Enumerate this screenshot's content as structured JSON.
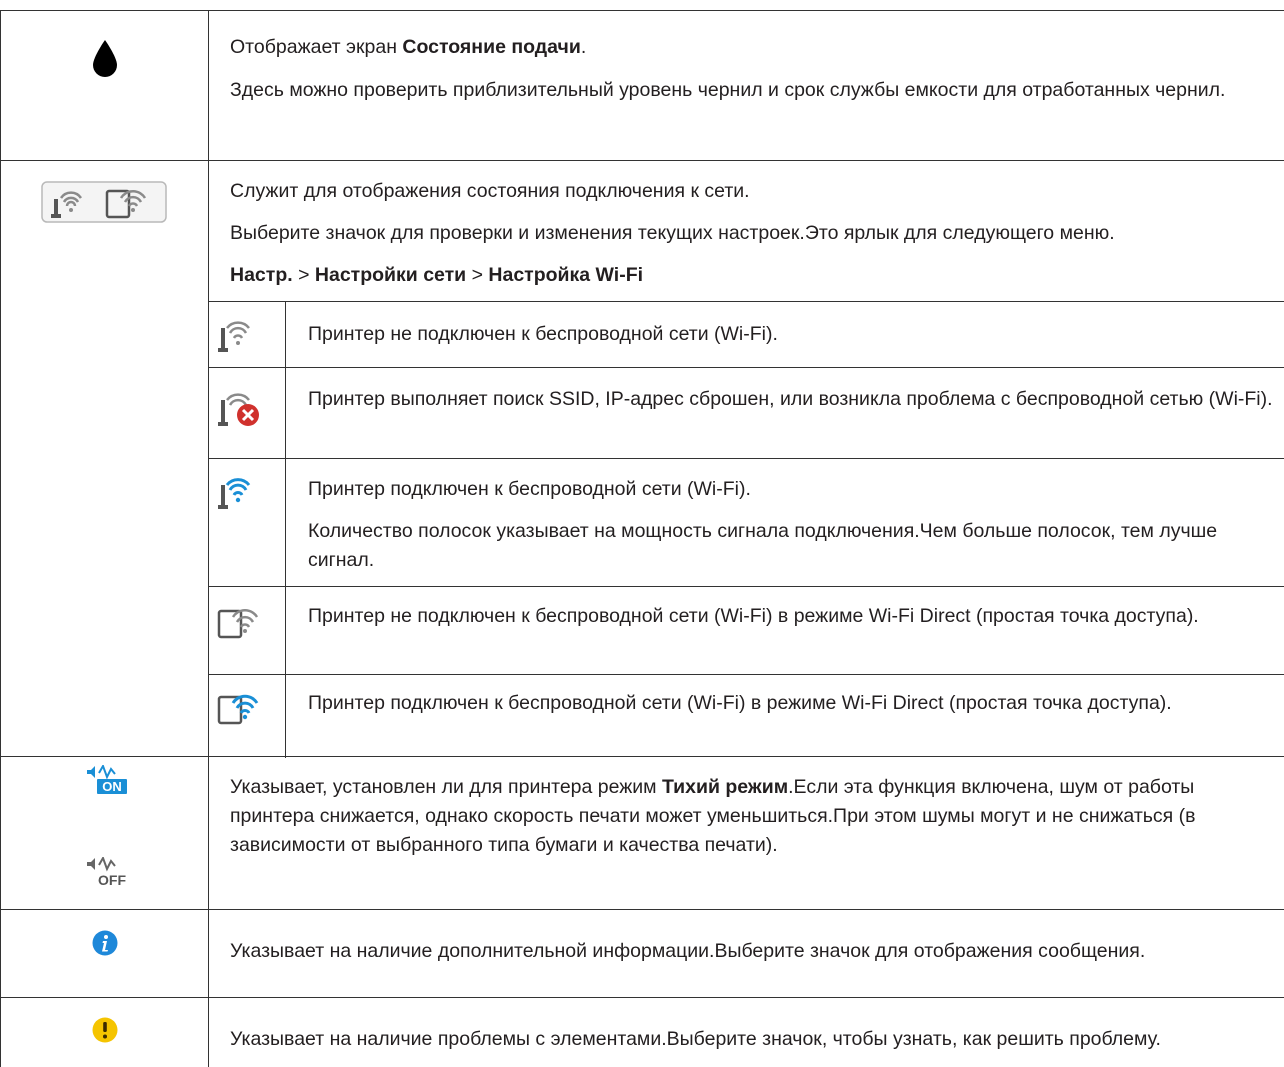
{
  "rows": {
    "supply": {
      "icon": "ink-drop-icon",
      "text1_pre": "Отображает экран ",
      "text1_bold": "Состояние подачи",
      "text1_post": ".",
      "text2": "Здесь можно проверить приблизительный уровень чернил и срок службы емкости для отработанных чернил."
    },
    "network": {
      "icon": "network-status-icon",
      "text1": "Служит для отображения состояния подключения к сети.",
      "text2": "Выберите значок для проверки и изменения текущих настроек.Это ярлык для следующего меню.",
      "path": {
        "item1": "Настр.",
        "sep1": " > ",
        "item2": "Настройки сети",
        "sep2": " > ",
        "item3": "Настройка Wi-Fi"
      },
      "subrows": [
        {
          "icon": "wifi-disconnected-icon",
          "text": "Принтер не подключен к беспроводной сети (Wi-Fi)."
        },
        {
          "icon": "wifi-error-icon",
          "text": "Принтер выполняет поиск SSID, IP-адрес сброшен, или возникла проблема с беспроводной сетью (Wi-Fi)."
        },
        {
          "icon": "wifi-connected-icon",
          "text": "Принтер подключен к беспроводной сети (Wi-Fi).",
          "text2": "Количество полосок указывает на мощность сигнала подключения.Чем больше полосок, тем лучше сигнал."
        },
        {
          "icon": "wifi-direct-disconnected-icon",
          "text": "Принтер не подключен к беспроводной сети (Wi-Fi) в режиме Wi-Fi Direct (простая точка доступа)."
        },
        {
          "icon": "wifi-direct-connected-icon",
          "text": "Принтер подключен к беспроводной сети (Wi-Fi) в режиме Wi-Fi Direct (простая точка доступа)."
        }
      ]
    },
    "quiet": {
      "icon_on": "quiet-mode-on-icon",
      "icon_off": "quiet-mode-off-icon",
      "icon_on_text": "ON",
      "icon_off_text": "OFF",
      "text_pre": "Указывает, установлен ли для принтера режим ",
      "text_bold": "Тихий режим",
      "text_post": ".Если эта функция включена, шум от работы принтера снижается, однако скорость печати может уменьшиться.При этом шумы могут и не снижаться (в зависимости от выбранного типа бумаги и качества печати)."
    },
    "info": {
      "icon": "info-icon",
      "text": "Указывает на наличие дополнительной информации.Выберите значок для отображения сообщения."
    },
    "warning": {
      "icon": "warning-icon",
      "text": "Указывает на наличие проблемы с элементами.Выберите значок, чтобы узнать, как решить проблему."
    }
  },
  "colors": {
    "wifi_blue": "#1a8fd6",
    "icon_gray": "#7a7a7a",
    "error_red": "#d0312d",
    "info_blue": "#1e88d9",
    "warning_yellow": "#f5c400"
  }
}
